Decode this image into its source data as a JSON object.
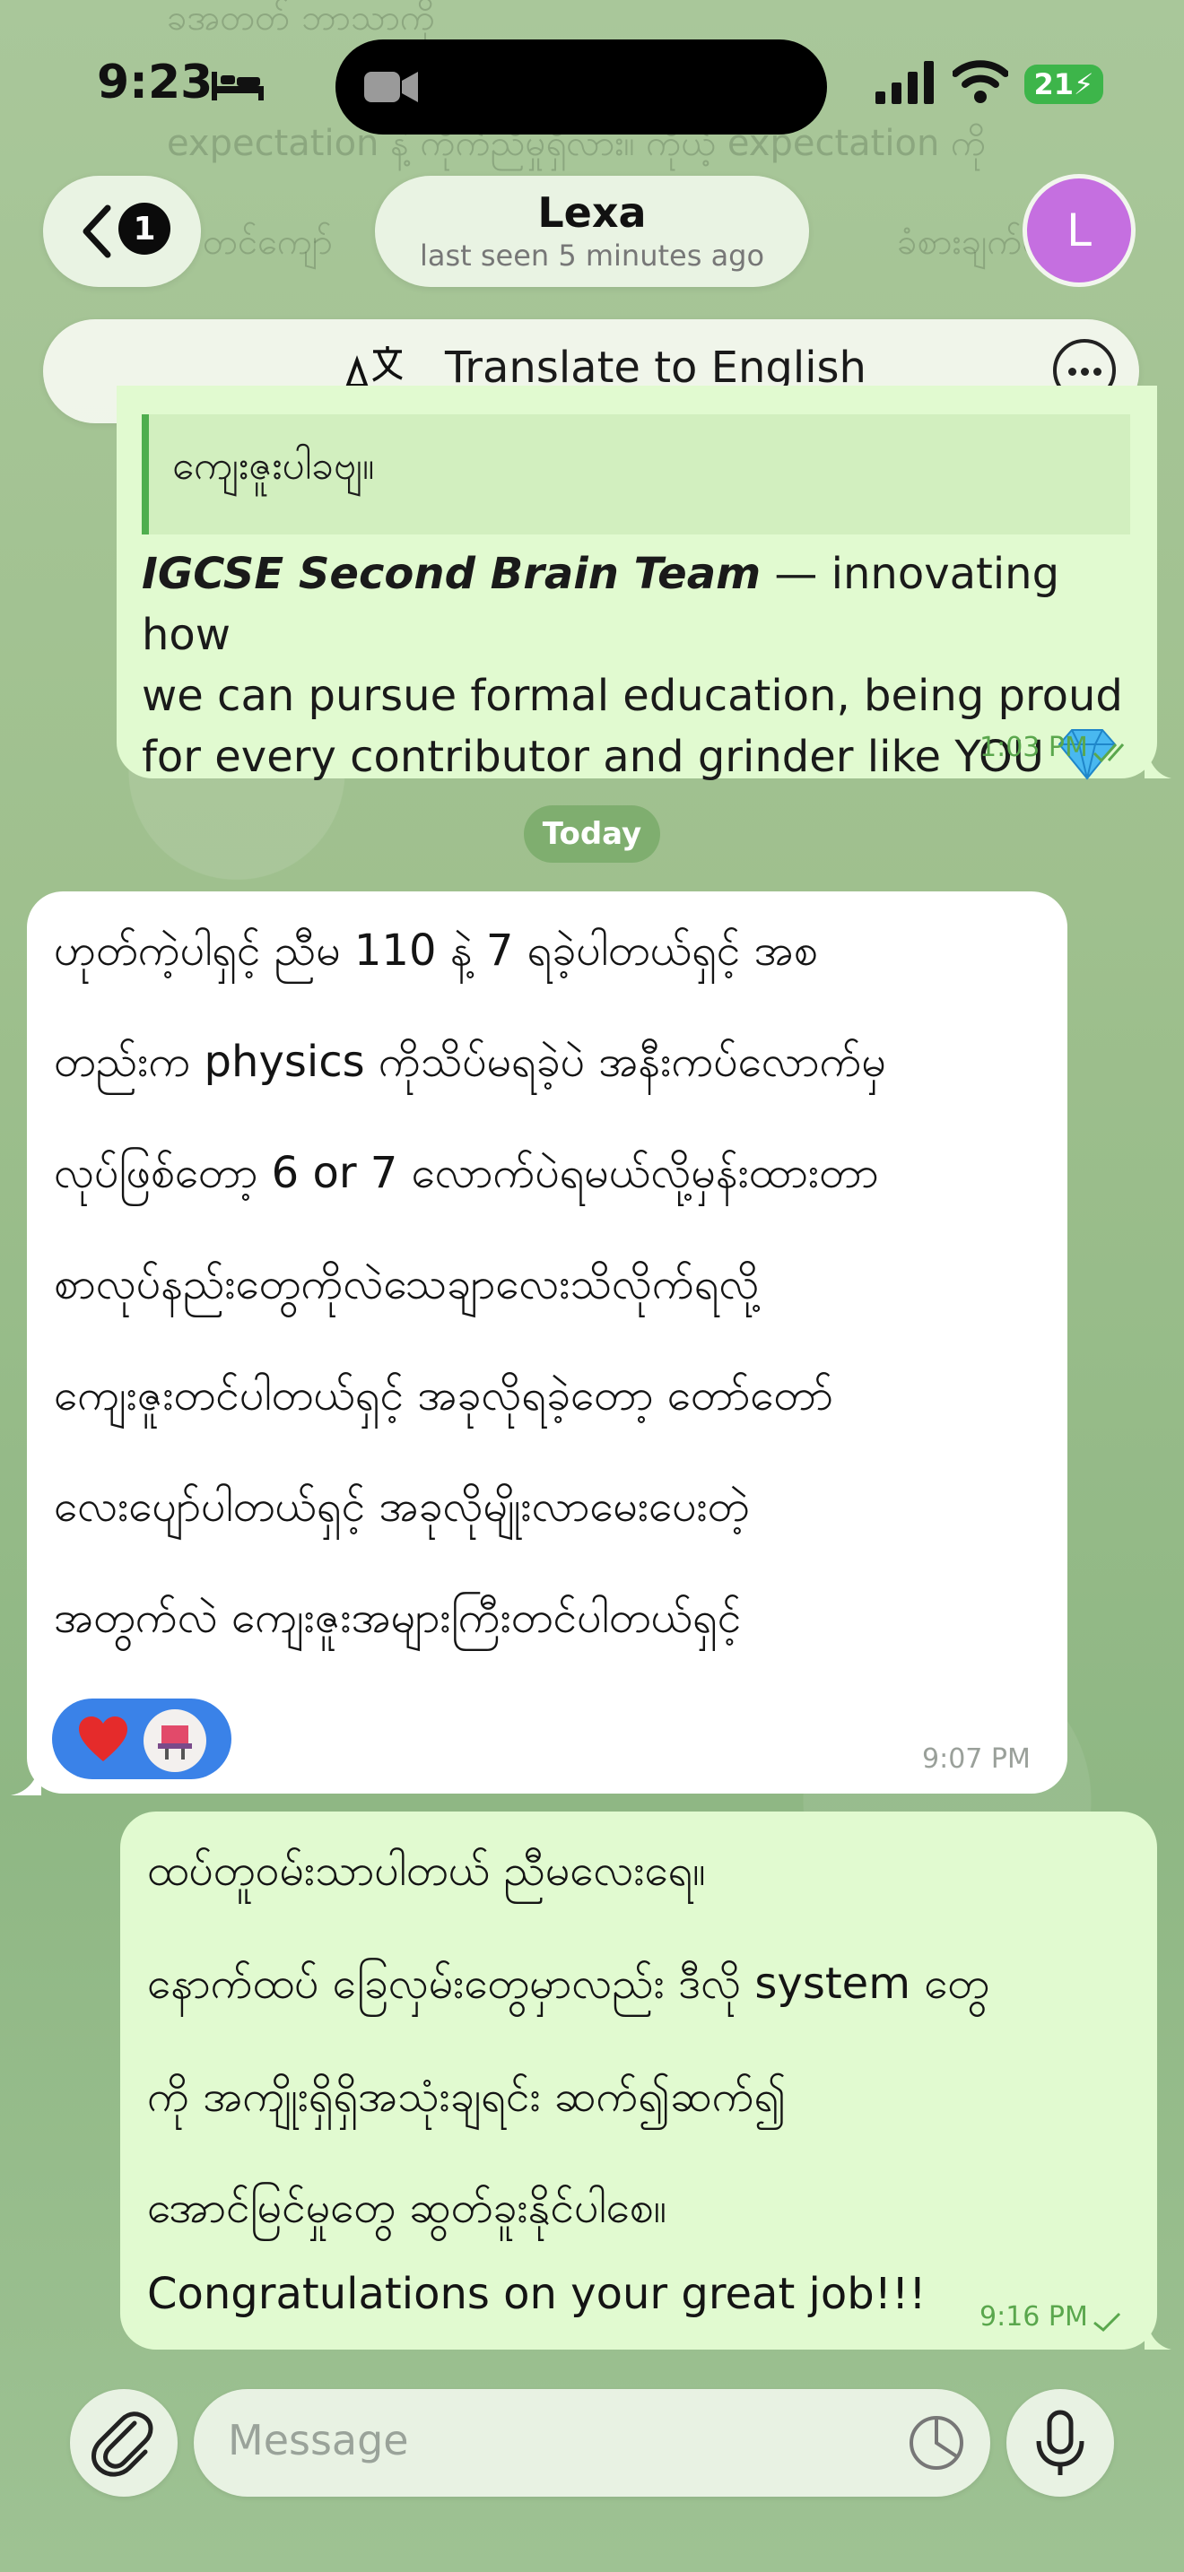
{
  "status_bar": {
    "time": "9:23",
    "battery": "21"
  },
  "header": {
    "unread_count": "1",
    "chat_name": "Lexa",
    "last_seen": "last seen 5 minutes ago",
    "avatar_initial": "L"
  },
  "translate_bar": {
    "label": "Translate to English"
  },
  "previous_message_fragments": [
    "ခအတတ် ဘာသာကို",
    "expectation နဲ့ ကိုက်ညီမှုရှိလား။ ကိုယ့် expectation ကို",
    "တင်ကျော်",
    "ခံစားချက်လေ"
  ],
  "outgoing_message_1": {
    "quote_text": "ကျေးဇူးပါခဗျ။",
    "brand": "IGCSE Second Brain Team",
    "text_line1_rest": " — innovating how",
    "text_line2": "we can pursue formal education, being proud",
    "text_line3": "for every contributor and grinder like YOU",
    "time": "1:03 PM"
  },
  "date_separator": "Today",
  "incoming_message": {
    "lines": [
      "ဟုတ်ကဲ့ပါရှင့် ညီမ 110 နဲ့ 7 ရခဲ့ပါတယ်ရှင့် အစ",
      "တည်းက physics ကိုသိပ်မရခဲ့ပဲ အနီးကပ်လောက်မှ",
      "လုပ်ဖြစ်တော့ 6 or 7 လောက်ပဲရမယ်လို့မှန်းထားတာ",
      "စာလုပ်နည်းတွေကိုလဲသေချာလေးသိလိုက်ရလို့",
      "ကျေးဇူးတင်ပါတယ်ရှင့် အခုလိုရခဲ့တော့ တော်တော်",
      "လေးပျော်ပါတယ်ရှင့် အခုလိုမျိုးလာမေးပေးတဲ့",
      "အတွက်လဲ ကျေးဇူးအများကြီးတင်ပါတယ်ရှင့်"
    ],
    "time": "9:07 PM",
    "reaction_icons": [
      "heart-icon",
      "sticker-avatar-icon"
    ]
  },
  "outgoing_message_2": {
    "lines": [
      "ထပ်တူဝမ်းသာပါတယ် ညီမလေးရေ။",
      "နောက်ထပ် ခြေလှမ်းတွေမှာလည်း ဒီလို system တွေ",
      "ကို အကျိုးရှိရှိအသုံးချရင်း ဆက်၍ဆက်၍",
      "အောင်မြင်မှုတွေ ဆွတ်ခူးနိုင်ပါစေ။",
      "Congratulations on your great job!!!"
    ],
    "time": "9:16 PM"
  },
  "composer": {
    "placeholder": "Message"
  },
  "colors": {
    "outgoing_bubble": "#e1fad0",
    "incoming_bubble": "#ffffff",
    "accent_green": "#4fae4e",
    "avatar": "#c56fe0",
    "reaction_bg": "#3a82e8",
    "date_pill": "#7fae6f"
  }
}
